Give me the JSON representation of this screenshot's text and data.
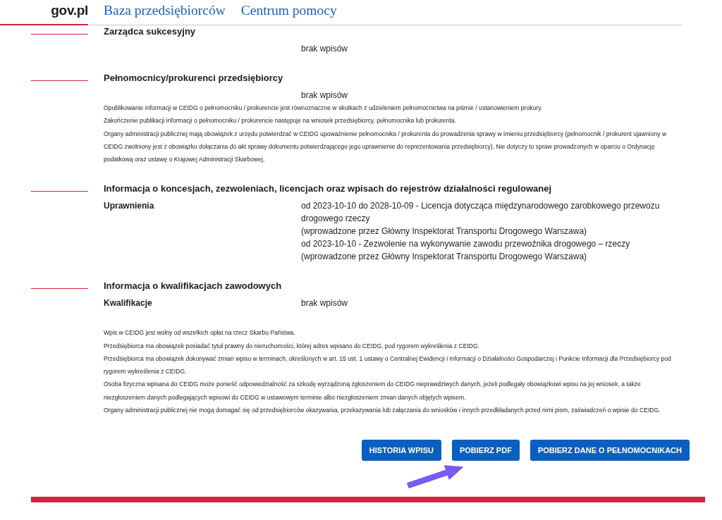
{
  "header": {
    "logo": "gov.pl",
    "links": [
      {
        "label": "Baza przedsiębiorców"
      },
      {
        "label": "Centrum pomocy"
      }
    ]
  },
  "sections": [
    {
      "title": "Zarządca sukcesyjny",
      "rows": [
        {
          "values": [
            "brak wpisów"
          ]
        }
      ]
    },
    {
      "title": "Pełnomocnicy/prokurenci przedsiębiorcy",
      "rows": [
        {
          "values": [
            "brak wpisów"
          ]
        }
      ],
      "notes": [
        "Opublikowanie informacji w CEIDG o pełnomocniku / prokurencie jest równoznaczne w skutkach z udzieleniem pełnomocnictwa na piśmie / ustanowieniem prokury.",
        "Zakończenie publikacji informacji o pełnomocniku / prokurencie następuje na wniosek przedsiębiorcy, pełnomocnika lub prokurenta.",
        "Organy administracji publicznej mają obowiązek z urzędu potwierdzać w CEIDG upoważnienie pełnomocnika / prokurenta do prowadzenia sprawy w imieniu przedsiębiorcy (pełnomocnik / prokurent ujawniony w CEIDG zwolniony jest z obowiązku dołączania do akt sprawy dokumentu potwierdzającego jego uprawnienie do reprezentowania przedsiębiorcy). Nie dotyczy to spraw prowadzonych w oparciu o Ordynację podatkową oraz ustawę o Krajowej Administracji Skarbowej."
      ]
    },
    {
      "title": "Informacja o koncesjach, zezwoleniach, licencjach oraz wpisach do rejestrów działalności regulowanej",
      "rows": [
        {
          "label": "Uprawnienia",
          "values": [
            "od 2023-10-10 do 2028-10-09 - Licencja dotycząca międzynarodowego zarobkowego przewozu drogowego rzeczy",
            "(wprowadzone przez Główny Inspektorat Transportu Drogowego Warszawa)",
            "od 2023-10-10 - Zezwolenie na wykonywanie zawodu przewoźnika drogowego – rzeczy",
            "(wprowadzone przez Główny Inspektorat Transportu Drogowego Warszawa)"
          ]
        }
      ]
    },
    {
      "title": "Informacja o kwalifikacjach zawodowych",
      "rows": [
        {
          "label": "Kwalifikacje",
          "values": [
            "brak wpisów"
          ]
        }
      ]
    }
  ],
  "notes": [
    "Wpis w CEIDG jest wolny od wszelkich opłat na rzecz Skarbu Państwa.",
    "Przedsiębiorca ma obowiązek posiadać tytuł prawny do nieruchomości, której adres wpisano do CEIDG, pod rygorem wykreślenia z CEIDG.",
    "Przedsiębiorca ma obowiązek dokonywać zmian wpisu w terminach, określonych w art. 15 ust. 1 ustawy o Centralnej Ewidencji i Informacji o Działalności Gospodarczej i Punkcie Informacji dla Przedsiębiorcy pod rygorem wykreślenia z CEIDG.",
    "Osoba fizyczna wpisana do CEIDG może ponieść odpowiedzialność za szkodę wyrządzoną zgłoszeniem do CEIDG nieprawdziwych danych, jeżeli podlegały obowiązkowi wpisu na jej wniosek, a także niezgłoszeniem danych podlegających wpisowi do CEIDG w ustawowym terminie albo niezgłoszeniem zmian danych objętych wpisem.",
    "Organy administracji publicznej nie mogą domagać się od przedsiębiorców okazywania, przekazywania lub załączania do wniosków i innych przedkładanych przed nimi pism, zaświadczeń o wpisie do CEIDG."
  ],
  "buttons": [
    {
      "label": "HISTORIA WPISU"
    },
    {
      "label": "POBIERZ PDF"
    },
    {
      "label": "POBIERZ DANE O PEŁNOMOCNIKACH"
    }
  ]
}
